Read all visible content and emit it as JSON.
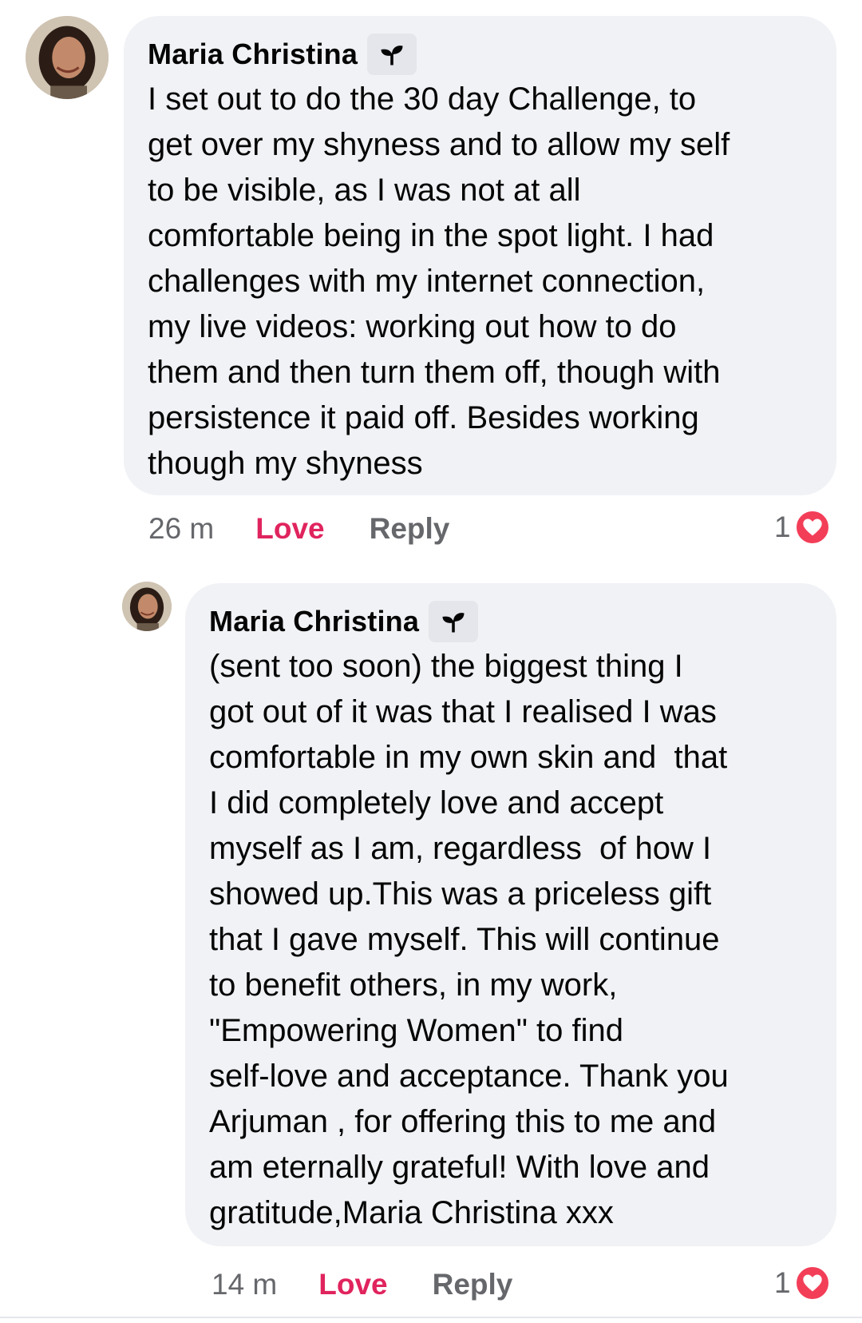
{
  "comments": [
    {
      "author": "Maria Christina",
      "badge_icon": "sprout-icon",
      "text_lines": [
        "I set out to do the 30 day Challenge, to",
        "get over my shyness and to allow my self",
        "to be visible, as I was not at all",
        "comfortable being in the spot light. I had",
        "challenges with my internet connection,",
        "my live videos: working out how to do",
        "them and then turn them off, though with",
        "persistence it paid off. Besides working",
        "though my shyness"
      ],
      "time": "26 m",
      "love_label": "Love",
      "reply_label": "Reply",
      "reaction_count": "1",
      "reaction_icon": "love-heart-icon"
    },
    {
      "author": "Maria Christina",
      "badge_icon": "sprout-icon",
      "text_lines": [
        "(sent too soon) the biggest thing I",
        "got out of it was that I realised I was",
        "comfortable in my own skin and  that",
        "I did completely love and accept",
        "myself as I am, regardless  of how I",
        "showed up.This was a priceless gift",
        "that I gave myself. This will continue",
        "to benefit others, in my work,",
        "\"Empowering Women\" to find",
        "self-love and acceptance. Thank you",
        "Arjuman , for offering this to me and",
        "am eternally grateful! With love and",
        "gratitude,Maria Christina xxx"
      ],
      "time": "14 m",
      "love_label": "Love",
      "reply_label": "Reply",
      "reaction_count": "1",
      "reaction_icon": "love-heart-icon"
    }
  ],
  "colors": {
    "bubble": "#f0f2f5",
    "love": "#e0245e",
    "meta": "#65676b",
    "heart": "#f33e58"
  }
}
